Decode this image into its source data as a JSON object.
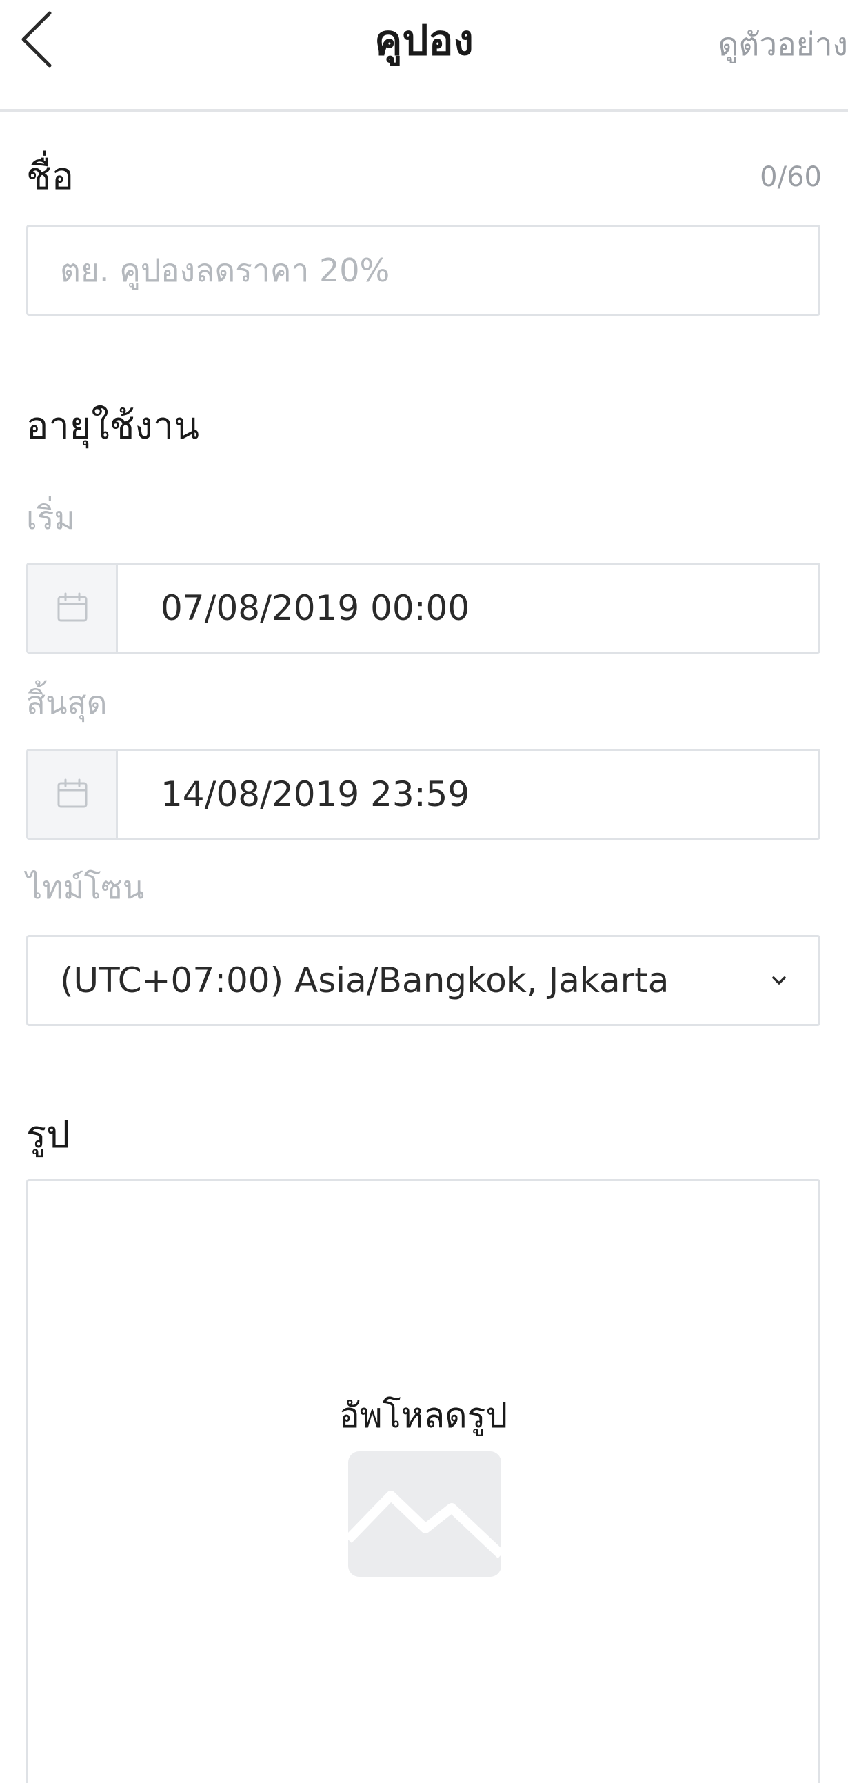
{
  "header": {
    "title": "คูปอง",
    "preview_label": "ดูตัวอย่าง",
    "back_icon": "chevron-left-icon"
  },
  "name_section": {
    "label": "ชื่อ",
    "counter": "0/60",
    "placeholder": "ตย. คูปองลดราคา 20%",
    "value": ""
  },
  "validity_section": {
    "label": "อายุใช้งาน",
    "start": {
      "label": "เริ่ม",
      "icon": "calendar-icon",
      "value": "07/08/2019 00:00"
    },
    "end": {
      "label": "สิ้นสุด",
      "icon": "calendar-icon",
      "value": "14/08/2019 23:59"
    },
    "timezone": {
      "label": "ไทม์โซน",
      "value": "(UTC+07:00) Asia/Bangkok, Jakarta",
      "icon": "chevron-down-icon"
    }
  },
  "image_section": {
    "label": "รูป",
    "upload_label": "อัพโหลดรูป",
    "icon": "image-placeholder-icon"
  },
  "colors": {
    "text_primary": "#1a1a1a",
    "text_muted": "#9a9ea4",
    "border": "#dfe2e6",
    "icon_fill": "#ebecee"
  }
}
